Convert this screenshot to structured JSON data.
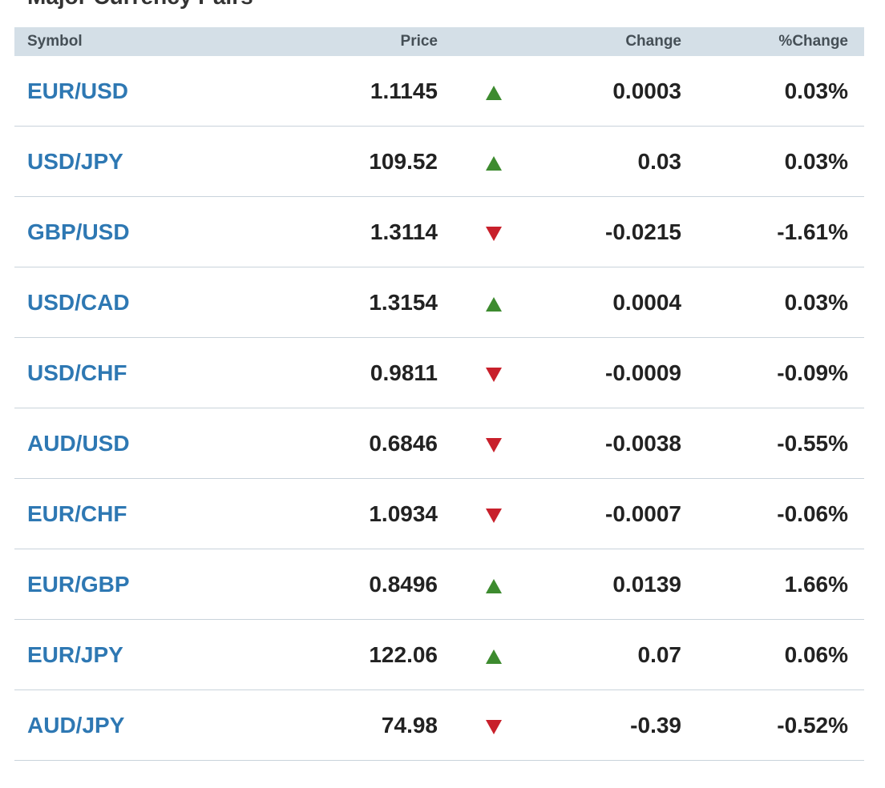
{
  "section": {
    "title": "Major Currency Pairs"
  },
  "table": {
    "headers": {
      "symbol": "Symbol",
      "price": "Price",
      "change": "Change",
      "pct_change": "%Change"
    },
    "rows": [
      {
        "symbol": "EUR/USD",
        "price": "1.1145",
        "direction": "up",
        "change": "0.0003",
        "pct_change": "0.03%"
      },
      {
        "symbol": "USD/JPY",
        "price": "109.52",
        "direction": "up",
        "change": "0.03",
        "pct_change": "0.03%"
      },
      {
        "symbol": "GBP/USD",
        "price": "1.3114",
        "direction": "down",
        "change": "-0.0215",
        "pct_change": "-1.61%"
      },
      {
        "symbol": "USD/CAD",
        "price": "1.3154",
        "direction": "up",
        "change": "0.0004",
        "pct_change": "0.03%"
      },
      {
        "symbol": "USD/CHF",
        "price": "0.9811",
        "direction": "down",
        "change": "-0.0009",
        "pct_change": "-0.09%"
      },
      {
        "symbol": "AUD/USD",
        "price": "0.6846",
        "direction": "down",
        "change": "-0.0038",
        "pct_change": "-0.55%"
      },
      {
        "symbol": "EUR/CHF",
        "price": "1.0934",
        "direction": "down",
        "change": "-0.0007",
        "pct_change": "-0.06%"
      },
      {
        "symbol": "EUR/GBP",
        "price": "0.8496",
        "direction": "up",
        "change": "0.0139",
        "pct_change": "1.66%"
      },
      {
        "symbol": "EUR/JPY",
        "price": "122.06",
        "direction": "up",
        "change": "0.07",
        "pct_change": "0.06%"
      },
      {
        "symbol": "AUD/JPY",
        "price": "74.98",
        "direction": "down",
        "change": "-0.39",
        "pct_change": "-0.52%"
      }
    ]
  },
  "colors": {
    "link": "#2e78b3",
    "up": "#3d8b2f",
    "down": "#c8202b",
    "header_bg": "#d4dfe7"
  },
  "icons": {
    "up": "triangle-up-icon",
    "down": "triangle-down-icon"
  }
}
